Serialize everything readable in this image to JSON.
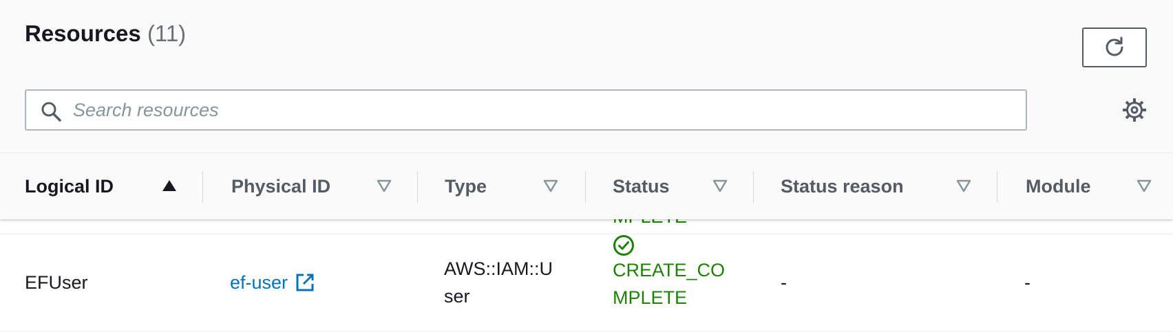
{
  "header": {
    "title": "Resources",
    "count": "(11)",
    "search_placeholder": "Search resources",
    "search_value": ""
  },
  "icons": {
    "refresh": "refresh-icon",
    "search": "search-icon",
    "settings": "gear-icon",
    "external_link": "external-link-icon",
    "status_success": "check-circle-icon"
  },
  "columns": [
    {
      "label": "Logical ID",
      "sort": "ascending"
    },
    {
      "label": "Physical ID",
      "sort": "none"
    },
    {
      "label": "Type",
      "sort": "none"
    },
    {
      "label": "Status",
      "sort": "none"
    },
    {
      "label": "Status reason",
      "sort": "none"
    },
    {
      "label": "Module",
      "sort": "none"
    }
  ],
  "previous_row_fragment": {
    "status_tail": "MPLETE"
  },
  "rows": [
    {
      "logical_id": "EFUser",
      "physical_id": "ef-user",
      "type_line1": "AWS::IAM::U",
      "type_line2": "ser",
      "status_line1": "CREATE_CO",
      "status_line2": "MPLETE",
      "status_reason": "-",
      "module": "-"
    }
  ],
  "colors": {
    "success": "#1d8102",
    "link": "#0073bb",
    "header_text": "#545b64"
  }
}
